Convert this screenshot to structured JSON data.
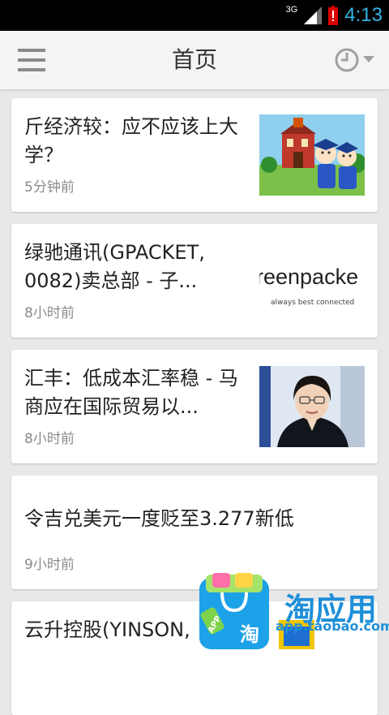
{
  "status": {
    "network": "3G",
    "time": "4:13"
  },
  "appbar": {
    "title": "首页"
  },
  "articles": [
    {
      "title": "斤经济较：应不应该上大学？",
      "time": "5分钟前"
    },
    {
      "title": "绿驰通讯(GPACKET, 0082)卖总部 - 子...",
      "time": "8小时前",
      "thumb_logo": "reenpacke",
      "thumb_tagline": "always best connected"
    },
    {
      "title": "汇丰：低成本汇率稳 - 马商应在国际贸易以...",
      "time": "8小时前"
    },
    {
      "title": "令吉兑美元一度贬至3.277新低",
      "time": "9小时前"
    },
    {
      "title": "云升控股(YINSON,"
    }
  ],
  "promo": {
    "brand": "淘应用",
    "url": "app.taobao.com",
    "bag_tag": "APP",
    "bag_char": "淘"
  },
  "colors": {
    "accent": "#33b5e5",
    "promo_blue": "#1f8fd9"
  }
}
